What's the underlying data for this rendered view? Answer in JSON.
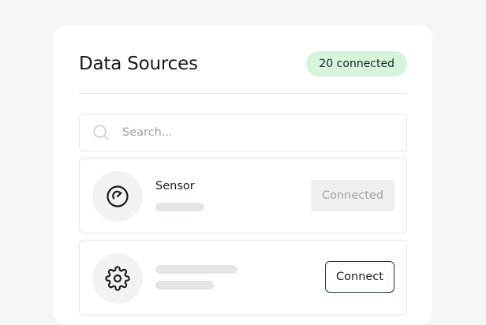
{
  "header": {
    "title": "Data Sources",
    "badge": "20 connected"
  },
  "search": {
    "placeholder": "Search...",
    "value": ""
  },
  "sources": [
    {
      "name": "Sensor",
      "icon": "gauge-icon",
      "action": "Connected",
      "status": "connected"
    },
    {
      "name": "",
      "icon": "gear-icon",
      "action": "Connect",
      "status": "disconnected"
    }
  ],
  "colors": {
    "background": "#f4f5f4",
    "badge_bg": "#d5f3dd",
    "button_border": "#1c3a36",
    "skeleton": "#e4e6e4"
  }
}
